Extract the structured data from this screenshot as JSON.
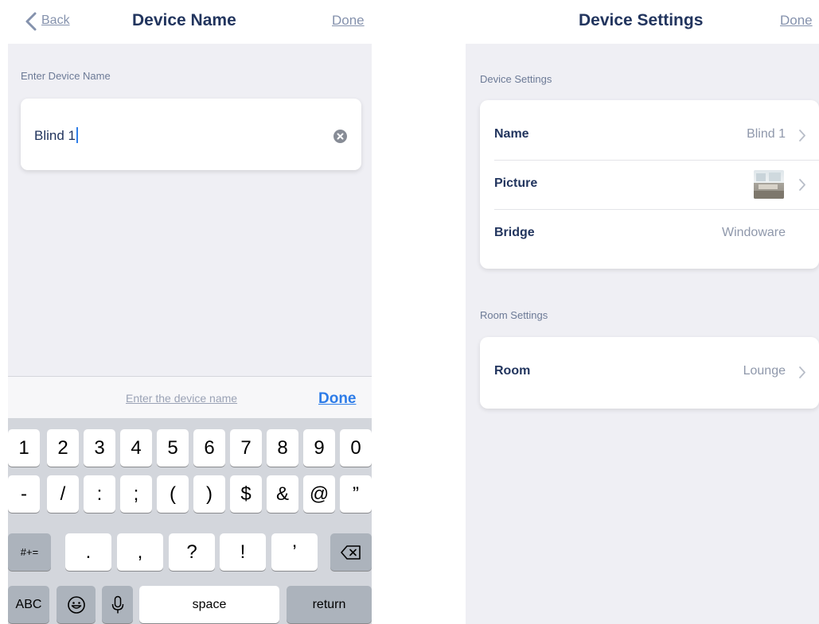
{
  "left_screen": {
    "nav": {
      "back_label": "Back",
      "title": "Device Name",
      "done_label": "Done"
    },
    "section_label": "Enter Device Name",
    "name_field": {
      "value": "Blind 1"
    },
    "accessory": {
      "hint": "Enter the device name",
      "done_label": "Done"
    },
    "keyboard": {
      "row1": [
        "1",
        "2",
        "3",
        "4",
        "5",
        "6",
        "7",
        "8",
        "9",
        "0"
      ],
      "row2": [
        "-",
        "/",
        ":",
        ";",
        "(",
        ")",
        "$",
        "&",
        "@",
        "”"
      ],
      "row3": {
        "toggle": "#+=",
        "keys": [
          ".",
          ",",
          "?",
          "!",
          "’"
        ]
      },
      "row4": {
        "abc": "ABC",
        "space": "space",
        "return": "return"
      }
    }
  },
  "right_screen": {
    "nav": {
      "title": "Device Settings",
      "done_label": "Done"
    },
    "device_section_label": "Device Settings",
    "device_rows": [
      {
        "label": "Name",
        "value": "Blind 1"
      },
      {
        "label": "Picture",
        "value": ""
      },
      {
        "label": "Bridge",
        "value": "Windoware"
      }
    ],
    "room_section_label": "Room Settings",
    "room_rows": [
      {
        "label": "Room",
        "value": "Lounge"
      }
    ]
  },
  "icons": {
    "back": "chevron-left-icon",
    "clear": "clear-circle-x-icon",
    "chevron": "chevron-right-icon",
    "emoji": "emoji-face-icon",
    "mic": "microphone-icon",
    "delete": "delete-backspace-icon"
  },
  "colors": {
    "title_navy": "#22355e",
    "link_gray": "#8592ad",
    "accent_blue": "#2d7ce8",
    "group_bg": "#efeff4",
    "keyboard_bg": "#d3d6dc"
  }
}
